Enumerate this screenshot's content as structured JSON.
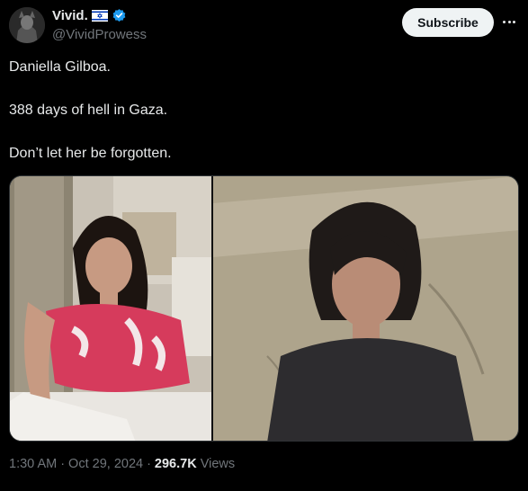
{
  "author": {
    "display_name": "Vivid.",
    "handle": "@VividProwess",
    "flag_icon": "israel-flag-icon",
    "verified_color": "#1d9bf0"
  },
  "actions": {
    "subscribe_label": "Subscribe",
    "more_icon": "more-horizontal-icon"
  },
  "tweet": {
    "lines": [
      "Daniella Gilboa.",
      "388 days of hell in Gaza.",
      "Don’t let her be forgotten."
    ]
  },
  "meta": {
    "time": "1:30 AM",
    "date": "Oct 29, 2024",
    "separator": "·",
    "views_count": "296.7K",
    "views_label": "Views"
  },
  "colors": {
    "background": "#000000",
    "text": "#e7e9ea",
    "secondary": "#71767b",
    "button_bg": "#eff3f4"
  }
}
